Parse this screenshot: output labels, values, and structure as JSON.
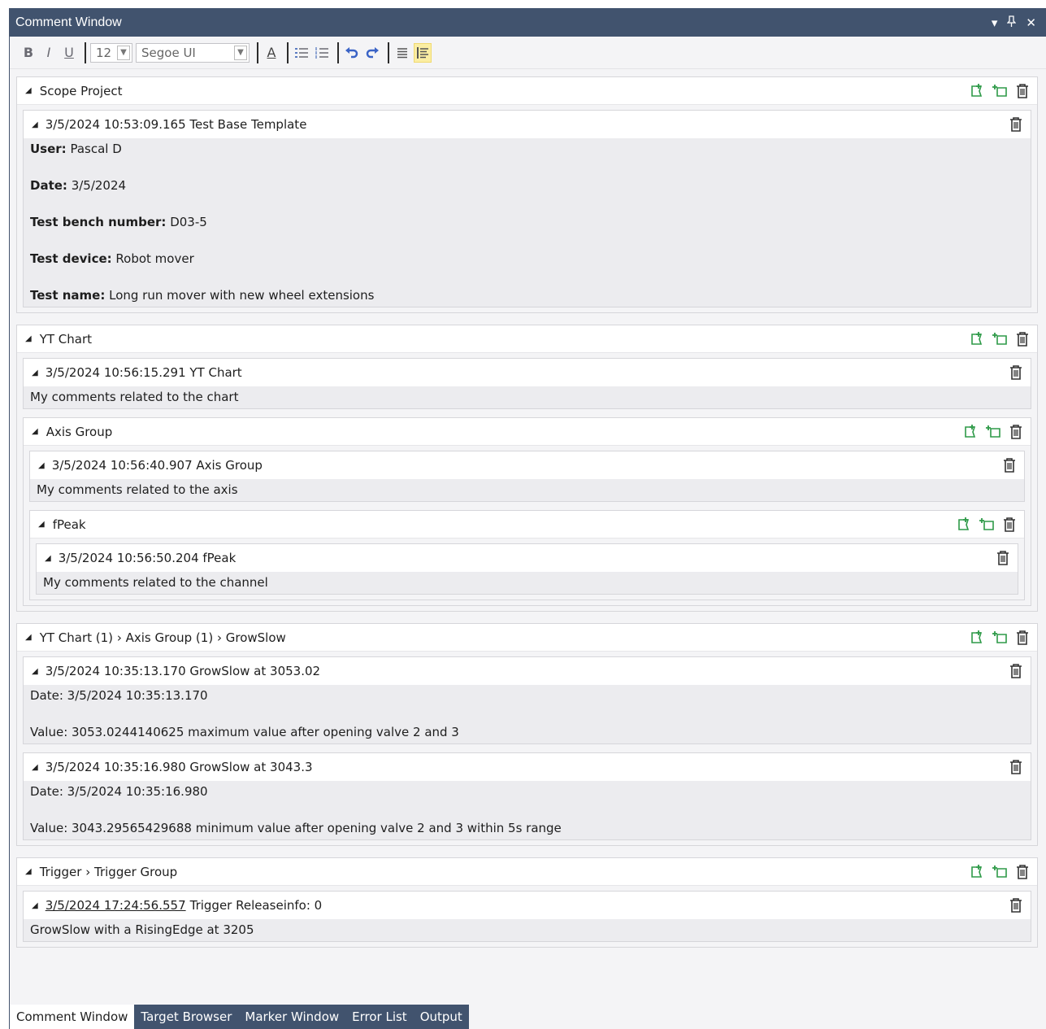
{
  "window": {
    "title": "Comment Window",
    "controls": [
      "▾",
      "⊥",
      "✕"
    ]
  },
  "toolbar": {
    "bold": "B",
    "italic": "I",
    "underline": "U",
    "font_size": "12",
    "font_name": "Segoe UI",
    "font_color": "A"
  },
  "groups": [
    {
      "title": "Scope Project",
      "comments": [
        {
          "header": "3/5/2024 10:53:09.165 Test Base Template",
          "lines": [
            {
              "key": "User:",
              "value": " Pascal D"
            },
            {
              "key": "Date:",
              "value": " 3/5/2024"
            },
            {
              "key": "Test bench number:",
              "value": " D03-5"
            },
            {
              "key": "Test device:",
              "value": " Robot mover"
            },
            {
              "key": "Test name:",
              "value": " Long run mover with new wheel extensions"
            }
          ]
        }
      ]
    },
    {
      "title": "YT Chart",
      "comment": {
        "header": "3/5/2024 10:56:15.291 YT Chart",
        "text": "My comments related to the chart"
      },
      "sub": {
        "title": "Axis Group",
        "comment": {
          "header": "3/5/2024 10:56:40.907 Axis Group",
          "text": "My comments related to the axis"
        },
        "sub": {
          "title": "fPeak",
          "comment": {
            "header": "3/5/2024 10:56:50.204 fPeak",
            "text": "My comments related to the channel"
          }
        }
      }
    },
    {
      "crumbs": [
        "YT Chart (1)",
        "Axis Group (1)",
        "GrowSlow"
      ],
      "comments": [
        {
          "header": "3/5/2024 10:35:13.170 GrowSlow at 3053.02",
          "line1": "Date: 3/5/2024 10:35:13.170",
          "line2": "Value: 3053.0244140625 maximum value after opening valve 2 and 3"
        },
        {
          "header": "3/5/2024 10:35:16.980 GrowSlow at 3043.3",
          "line1": "Date: 3/5/2024 10:35:16.980",
          "line2": "Value: 3043.29565429688 minimum value after opening valve 2 and 3 within 5s range"
        }
      ]
    },
    {
      "crumbs": [
        "Trigger",
        "Trigger Group"
      ],
      "comment": {
        "link": "3/5/2024 17:24:56.557",
        "header_rest": "Trigger Releaseinfo: 0",
        "text": "GrowSlow with a RisingEdge at 3205"
      }
    }
  ],
  "tabs": [
    "Comment Window",
    "Target Browser",
    "Marker Window",
    "Error List",
    "Output"
  ],
  "colors": {
    "titlebar": "#41536e",
    "tab_inactive": "#41536e",
    "accent_green": "#2e9a48",
    "highlight": "#fbeea3"
  }
}
